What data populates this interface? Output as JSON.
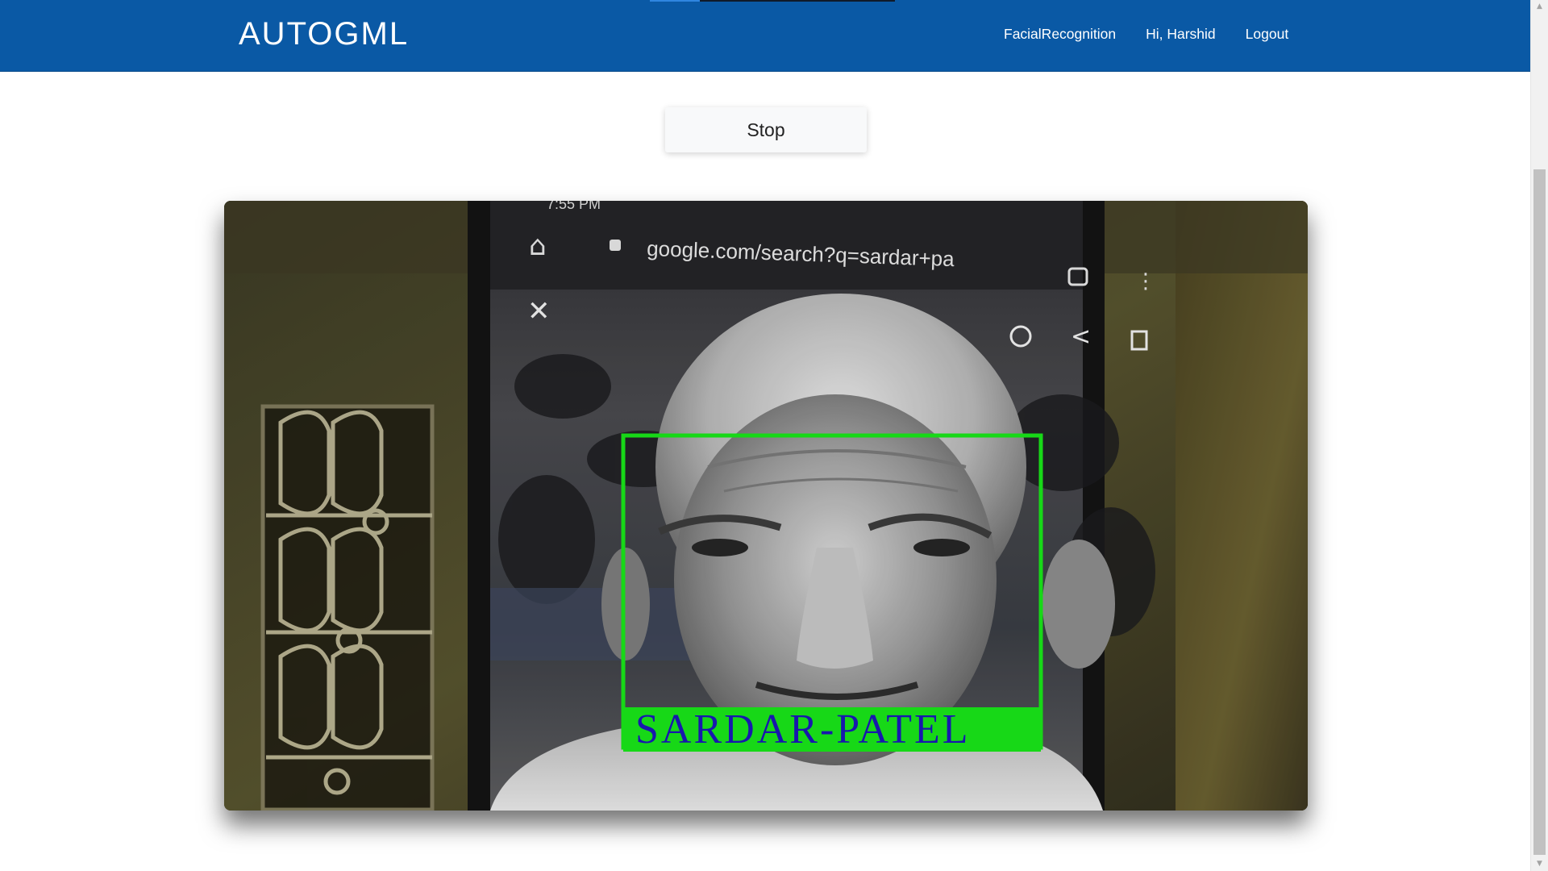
{
  "navbar": {
    "brand": "AUTOGML",
    "links": [
      {
        "label": "FacialRecognition"
      },
      {
        "label": "Hi, Harshid"
      },
      {
        "label": "Logout"
      }
    ],
    "bg_color": "#0a59a5"
  },
  "controls": {
    "stop_label": "Stop"
  },
  "video": {
    "url_bar_text": "google.com/search?q=sardar+pa",
    "status_time": "7:55 PM",
    "detection_label": "SARDAR-PATEL",
    "detection_box_color": "#19e619",
    "detection_label_color": "#1a1ab8"
  }
}
